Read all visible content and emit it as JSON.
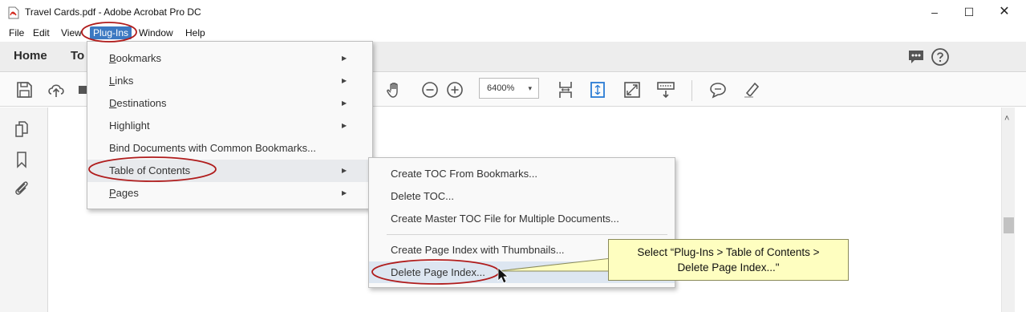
{
  "window": {
    "title": "Travel Cards.pdf - Adobe Acrobat Pro DC",
    "minimize_label": "–",
    "maximize_label": "☐",
    "close_label": "✕"
  },
  "menubar": {
    "items": [
      "File",
      "Edit",
      "View",
      "Plug-Ins",
      "Window",
      "Help"
    ],
    "active": "Plug-Ins"
  },
  "tabs": [
    "Home",
    "To"
  ],
  "toolbar": {
    "zoom_value": "6400%",
    "zoom_caret": "▾"
  },
  "plugins_menu": {
    "items": [
      {
        "label": "Bookmarks",
        "underline": "B",
        "rest": "ookmarks",
        "has_submenu": true
      },
      {
        "label": "Links",
        "underline": "L",
        "rest": "inks",
        "has_submenu": true
      },
      {
        "label": "Destinations",
        "underline": "D",
        "rest": "estinations",
        "has_submenu": true
      },
      {
        "label": "Highlight",
        "underline": "",
        "rest": "Highlight",
        "has_submenu": true
      },
      {
        "label": "Bind Documents with Common Bookmarks...",
        "underline": "",
        "rest": "Bind Documents with Common Bookmarks...",
        "has_submenu": false
      },
      {
        "label": "Table of Contents",
        "underline": "",
        "rest": "Table of Contents",
        "has_submenu": true
      },
      {
        "label": "Pages",
        "underline": "P",
        "rest": "ages",
        "has_submenu": true
      }
    ],
    "arrow": "▶"
  },
  "toc_submenu": {
    "items": [
      "Create TOC From Bookmarks...",
      "Delete TOC...",
      "Create Master TOC File for Multiple Documents...",
      "Create Page Index with Thumbnails...",
      "Delete Page Index..."
    ]
  },
  "callout": {
    "line1": "Select “Plug-Ins > Table of Contents >",
    "line2": "Delete Page Index...\""
  },
  "scrollbar": {
    "up_arrow": "˄"
  },
  "colors": {
    "menu_highlight": "#3c79c2",
    "annotation_ellipse": "#b01c1c",
    "callout_bg": "#fefec0",
    "icon_blue": "#2a7bd4"
  }
}
